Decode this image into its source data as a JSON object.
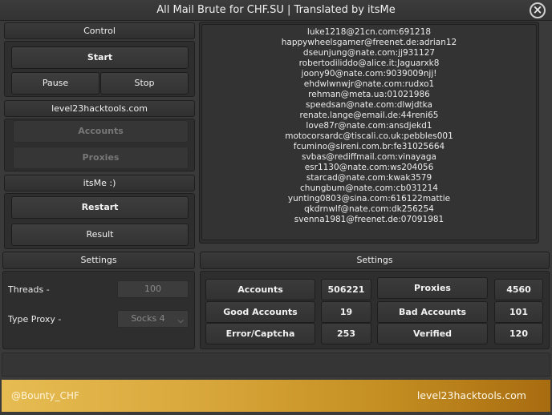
{
  "window": {
    "title": "All Mail Brute for CHF.SU | Translated by itsMe",
    "close_icon": "×"
  },
  "left": {
    "control_header": "Control",
    "start": "Start",
    "pause": "Pause",
    "stop": "Stop",
    "site_header": "level23hacktools.com",
    "accounts": "Accounts",
    "proxies": "Proxies",
    "author_header": "itsMe :)",
    "restart": "Restart",
    "result": "Result",
    "settings_header": "Settings",
    "threads_label": "Threads -",
    "threads_value": "100",
    "proxy_label": "Type Proxy -",
    "proxy_value": "Socks 4",
    "chevron_icon": "chevron-down-icon"
  },
  "output_lines": [
    "luke1218@21cn.com:691218",
    "happywheelsgamer@freenet.de:adrian12",
    "dseunjung@nate.com:jj931127",
    "robertodiliddo@alice.it:Jaguarxk8",
    "joony90@nate.com:9039009njj!",
    "ehdwlwnwjr@nate.com:rudxo1",
    "rehman@meta.ua:01021986",
    "speedsan@nate.com:dlwjdtka",
    "renate.lange@email.de:44reni65",
    "love87r@nate.com:ansdjekd1",
    "motocorsardc@tiscali.co.uk:pebbles001",
    "fcumino@sireni.com.br:fe31025664",
    "svbas@rediffmail.com:vinayaga",
    "esr1130@nate.com:ws204056",
    "starcad@nate.com:kwak3579",
    "chungbum@nate.com:cb031214",
    "yunting0803@sina.com:616122mattie",
    "qkdrnwlf@nate.com:dk256254",
    "svenna1981@freenet.de:07091981"
  ],
  "stats": {
    "header": "Settings",
    "accounts_label": "Accounts",
    "accounts_value": "506221",
    "proxies_label": "Proxies",
    "proxies_value": "4560",
    "good_label": "Good Accounts",
    "good_value": "19",
    "bad_label": "Bad Accounts",
    "bad_value": "101",
    "error_label": "Error/Captcha",
    "error_value": "253",
    "verified_label": "Verified",
    "verified_value": "120"
  },
  "footer": {
    "left": "@Bounty_CHF",
    "right": "level23hacktools.com"
  },
  "colors": {
    "background": "#3a3a3a",
    "panel": "#2e2e2e",
    "footer_start": "#e6bc52",
    "footer_end": "#a86c10"
  }
}
